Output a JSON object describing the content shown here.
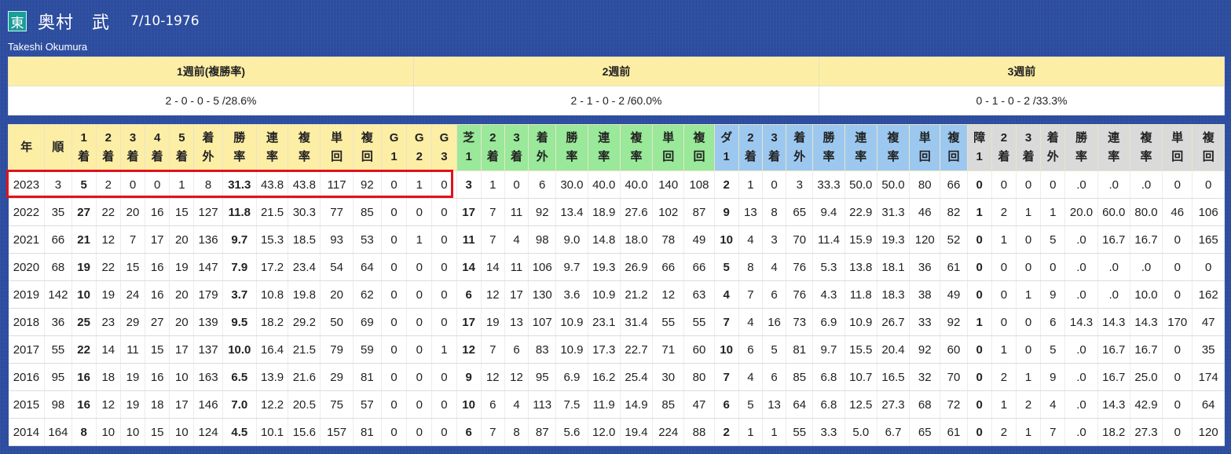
{
  "jockey": {
    "badge": "東",
    "name": "奥村　武",
    "birthdate": "7/10-1976",
    "romanized": "Takeshi Okumura"
  },
  "recent_weeks": {
    "headers": [
      "1週前(複勝率)",
      "2週前",
      "3週前"
    ],
    "values": [
      "2 - 0 - 0 - 5 /28.6%",
      "2 - 1 - 0 - 2 /60.0%",
      "0 - 1 - 0 - 2 /33.3%"
    ]
  },
  "stats_table": {
    "columns": [
      {
        "label": "年",
        "group": "overall"
      },
      {
        "label": "順",
        "group": "overall"
      },
      {
        "label": "1着",
        "group": "overall"
      },
      {
        "label": "2着",
        "group": "overall"
      },
      {
        "label": "3着",
        "group": "overall"
      },
      {
        "label": "4着",
        "group": "overall"
      },
      {
        "label": "5着",
        "group": "overall"
      },
      {
        "label": "着外",
        "group": "overall"
      },
      {
        "label": "勝率",
        "group": "overall"
      },
      {
        "label": "連率",
        "group": "overall"
      },
      {
        "label": "複率",
        "group": "overall"
      },
      {
        "label": "単回",
        "group": "overall"
      },
      {
        "label": "複回",
        "group": "overall"
      },
      {
        "label": "G1",
        "group": "overall"
      },
      {
        "label": "G2",
        "group": "overall"
      },
      {
        "label": "G3",
        "group": "overall"
      },
      {
        "label": "芝1",
        "group": "turf"
      },
      {
        "label": "2着",
        "group": "turf"
      },
      {
        "label": "3着",
        "group": "turf"
      },
      {
        "label": "着外",
        "group": "turf"
      },
      {
        "label": "勝率",
        "group": "turf"
      },
      {
        "label": "連率",
        "group": "turf"
      },
      {
        "label": "複率",
        "group": "turf"
      },
      {
        "label": "単回",
        "group": "turf"
      },
      {
        "label": "複回",
        "group": "turf"
      },
      {
        "label": "ダ1",
        "group": "dirt"
      },
      {
        "label": "2着",
        "group": "dirt"
      },
      {
        "label": "3着",
        "group": "dirt"
      },
      {
        "label": "着外",
        "group": "dirt"
      },
      {
        "label": "勝率",
        "group": "dirt"
      },
      {
        "label": "連率",
        "group": "dirt"
      },
      {
        "label": "複率",
        "group": "dirt"
      },
      {
        "label": "単回",
        "group": "dirt"
      },
      {
        "label": "複回",
        "group": "dirt"
      },
      {
        "label": "障1",
        "group": "obstacle"
      },
      {
        "label": "2着",
        "group": "obstacle"
      },
      {
        "label": "3着",
        "group": "obstacle"
      },
      {
        "label": "着外",
        "group": "obstacle"
      },
      {
        "label": "勝率",
        "group": "obstacle"
      },
      {
        "label": "連率",
        "group": "obstacle"
      },
      {
        "label": "複率",
        "group": "obstacle"
      },
      {
        "label": "単回",
        "group": "obstacle"
      },
      {
        "label": "複回",
        "group": "obstacle"
      }
    ],
    "bold_columns": [
      2,
      8,
      16,
      25,
      34
    ],
    "rows": [
      [
        "2023",
        "3",
        "5",
        "2",
        "0",
        "0",
        "1",
        "8",
        "31.3",
        "43.8",
        "43.8",
        "117",
        "92",
        "0",
        "1",
        "0",
        "3",
        "1",
        "0",
        "6",
        "30.0",
        "40.0",
        "40.0",
        "140",
        "108",
        "2",
        "1",
        "0",
        "3",
        "33.3",
        "50.0",
        "50.0",
        "80",
        "66",
        "0",
        "0",
        "0",
        "0",
        ".0",
        ".0",
        ".0",
        "0",
        "0"
      ],
      [
        "2022",
        "35",
        "27",
        "22",
        "20",
        "16",
        "15",
        "127",
        "11.8",
        "21.5",
        "30.3",
        "77",
        "85",
        "0",
        "0",
        "0",
        "17",
        "7",
        "11",
        "92",
        "13.4",
        "18.9",
        "27.6",
        "102",
        "87",
        "9",
        "13",
        "8",
        "65",
        "9.4",
        "22.9",
        "31.3",
        "46",
        "82",
        "1",
        "2",
        "1",
        "1",
        "20.0",
        "60.0",
        "80.0",
        "46",
        "106"
      ],
      [
        "2021",
        "66",
        "21",
        "12",
        "7",
        "17",
        "20",
        "136",
        "9.7",
        "15.3",
        "18.5",
        "93",
        "53",
        "0",
        "1",
        "0",
        "11",
        "7",
        "4",
        "98",
        "9.0",
        "14.8",
        "18.0",
        "78",
        "49",
        "10",
        "4",
        "3",
        "70",
        "11.4",
        "15.9",
        "19.3",
        "120",
        "52",
        "0",
        "1",
        "0",
        "5",
        ".0",
        "16.7",
        "16.7",
        "0",
        "165"
      ],
      [
        "2020",
        "68",
        "19",
        "22",
        "15",
        "16",
        "19",
        "147",
        "7.9",
        "17.2",
        "23.4",
        "54",
        "64",
        "0",
        "0",
        "0",
        "14",
        "14",
        "11",
        "106",
        "9.7",
        "19.3",
        "26.9",
        "66",
        "66",
        "5",
        "8",
        "4",
        "76",
        "5.3",
        "13.8",
        "18.1",
        "36",
        "61",
        "0",
        "0",
        "0",
        "0",
        ".0",
        ".0",
        ".0",
        "0",
        "0"
      ],
      [
        "2019",
        "142",
        "10",
        "19",
        "24",
        "16",
        "20",
        "179",
        "3.7",
        "10.8",
        "19.8",
        "20",
        "62",
        "0",
        "0",
        "0",
        "6",
        "12",
        "17",
        "130",
        "3.6",
        "10.9",
        "21.2",
        "12",
        "63",
        "4",
        "7",
        "6",
        "76",
        "4.3",
        "11.8",
        "18.3",
        "38",
        "49",
        "0",
        "0",
        "1",
        "9",
        ".0",
        ".0",
        "10.0",
        "0",
        "162"
      ],
      [
        "2018",
        "36",
        "25",
        "23",
        "29",
        "27",
        "20",
        "139",
        "9.5",
        "18.2",
        "29.2",
        "50",
        "69",
        "0",
        "0",
        "0",
        "17",
        "19",
        "13",
        "107",
        "10.9",
        "23.1",
        "31.4",
        "55",
        "55",
        "7",
        "4",
        "16",
        "73",
        "6.9",
        "10.9",
        "26.7",
        "33",
        "92",
        "1",
        "0",
        "0",
        "6",
        "14.3",
        "14.3",
        "14.3",
        "170",
        "47"
      ],
      [
        "2017",
        "55",
        "22",
        "14",
        "11",
        "15",
        "17",
        "137",
        "10.0",
        "16.4",
        "21.5",
        "79",
        "59",
        "0",
        "0",
        "1",
        "12",
        "7",
        "6",
        "83",
        "10.9",
        "17.3",
        "22.7",
        "71",
        "60",
        "10",
        "6",
        "5",
        "81",
        "9.7",
        "15.5",
        "20.4",
        "92",
        "60",
        "0",
        "1",
        "0",
        "5",
        ".0",
        "16.7",
        "16.7",
        "0",
        "35"
      ],
      [
        "2016",
        "95",
        "16",
        "18",
        "19",
        "16",
        "10",
        "163",
        "6.5",
        "13.9",
        "21.6",
        "29",
        "81",
        "0",
        "0",
        "0",
        "9",
        "12",
        "12",
        "95",
        "6.9",
        "16.2",
        "25.4",
        "30",
        "80",
        "7",
        "4",
        "6",
        "85",
        "6.8",
        "10.7",
        "16.5",
        "32",
        "70",
        "0",
        "2",
        "1",
        "9",
        ".0",
        "16.7",
        "25.0",
        "0",
        "174"
      ],
      [
        "2015",
        "98",
        "16",
        "12",
        "19",
        "18",
        "17",
        "146",
        "7.0",
        "12.2",
        "20.5",
        "75",
        "57",
        "0",
        "0",
        "0",
        "10",
        "6",
        "4",
        "113",
        "7.5",
        "11.9",
        "14.9",
        "85",
        "47",
        "6",
        "5",
        "13",
        "64",
        "6.8",
        "12.5",
        "27.3",
        "68",
        "72",
        "0",
        "1",
        "2",
        "4",
        ".0",
        "14.3",
        "42.9",
        "0",
        "64"
      ],
      [
        "2014",
        "164",
        "8",
        "10",
        "10",
        "15",
        "10",
        "124",
        "4.5",
        "10.1",
        "15.6",
        "157",
        "81",
        "0",
        "0",
        "0",
        "6",
        "7",
        "8",
        "87",
        "5.6",
        "12.0",
        "19.4",
        "224",
        "88",
        "2",
        "1",
        "1",
        "55",
        "3.3",
        "5.0",
        "6.7",
        "65",
        "61",
        "0",
        "2",
        "1",
        "7",
        ".0",
        "18.2",
        "27.3",
        "0",
        "120"
      ]
    ],
    "highlighted_row": "2023",
    "highlight_color": "#e0121a"
  },
  "colors": {
    "background": "#2d4da0",
    "header_yellow": "#fdeea6",
    "header_green": "#9ae89a",
    "header_blue": "#9cc8f0",
    "header_gray": "#dadada"
  }
}
